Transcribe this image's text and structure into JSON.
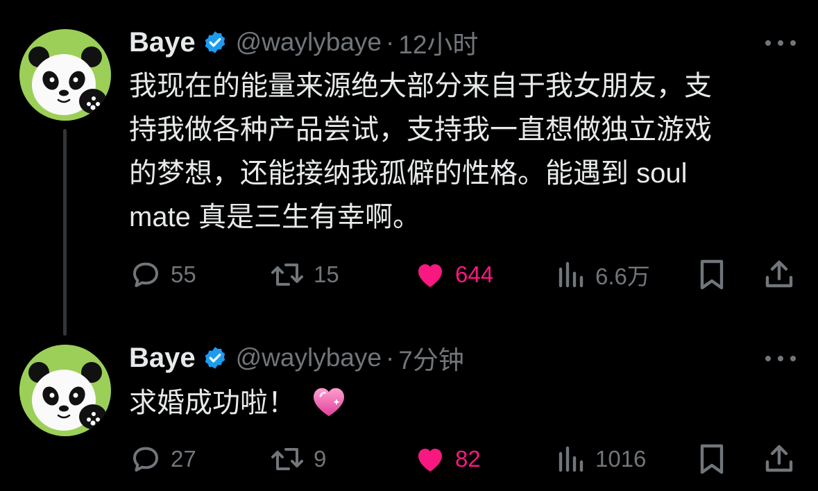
{
  "colors": {
    "background": "#000000",
    "text": "#e7e9ea",
    "muted": "#71767b",
    "like": "#f91880",
    "verified": "#1d9bf0",
    "avatar_bg": "#9ccf58"
  },
  "tweets": [
    {
      "author": {
        "name": "Baye",
        "handle": "@waylybaye",
        "verified_icon": "verified-badge-icon",
        "avatar_icon": "panda-avatar"
      },
      "separator": "·",
      "time": "12小时",
      "lines": [
        "我现在的能量来源绝大部分来自于我女朋友，支",
        "持我做各种产品尝试，支持我一直想做独立游戏",
        "的梦想，还能接纳我孤僻的性格。能遇到 soul",
        "mate 真是三生有幸啊。"
      ],
      "emoji": null,
      "stats": {
        "replies": "55",
        "retweets": "15",
        "likes": "644",
        "views": "6.6万"
      },
      "liked": true
    },
    {
      "author": {
        "name": "Baye",
        "handle": "@waylybaye",
        "verified_icon": "verified-badge-icon",
        "avatar_icon": "panda-avatar"
      },
      "separator": "·",
      "time": "7分钟",
      "lines": [
        "求婚成功啦！"
      ],
      "emoji": "sparkling-heart-emoji",
      "stats": {
        "replies": "27",
        "retweets": "9",
        "likes": "82",
        "views": "1016"
      },
      "liked": true
    }
  ],
  "icons": {
    "more": "more-options-icon",
    "reply": "reply-bubble-icon",
    "retweet": "retweet-icon",
    "like": "heart-filled-icon",
    "views": "views-bar-chart-icon",
    "bookmark": "bookmark-icon",
    "share": "share-upload-icon"
  }
}
